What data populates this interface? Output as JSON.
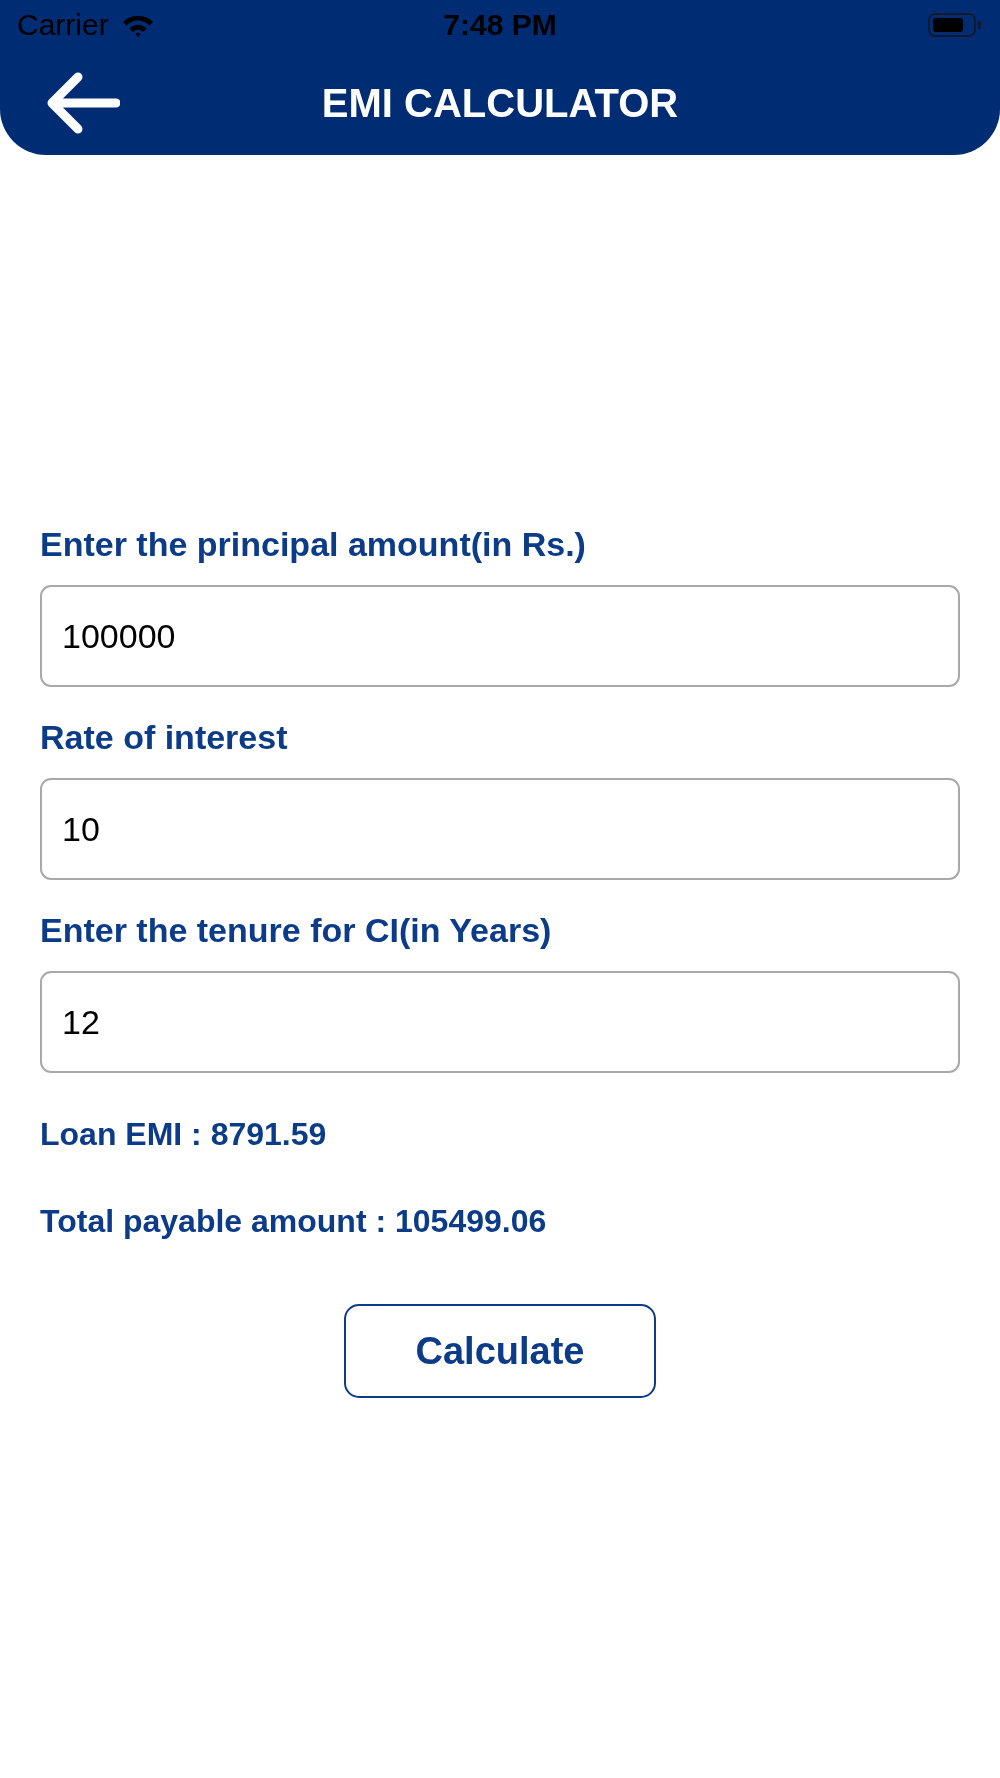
{
  "status_bar": {
    "carrier": "Carrier",
    "time": "7:48 PM"
  },
  "header": {
    "title": "EMI CALCULATOR"
  },
  "fields": [
    {
      "label": "Enter the principal amount(in Rs.)",
      "value": "100000"
    },
    {
      "label": "Rate of interest",
      "value": "10"
    },
    {
      "label": "Enter the tenure for CI(in Years)",
      "value": "12"
    }
  ],
  "results": [
    "Loan EMI : 8791.59",
    "Total payable amount : 105499.06"
  ],
  "button": {
    "label": "Calculate"
  }
}
